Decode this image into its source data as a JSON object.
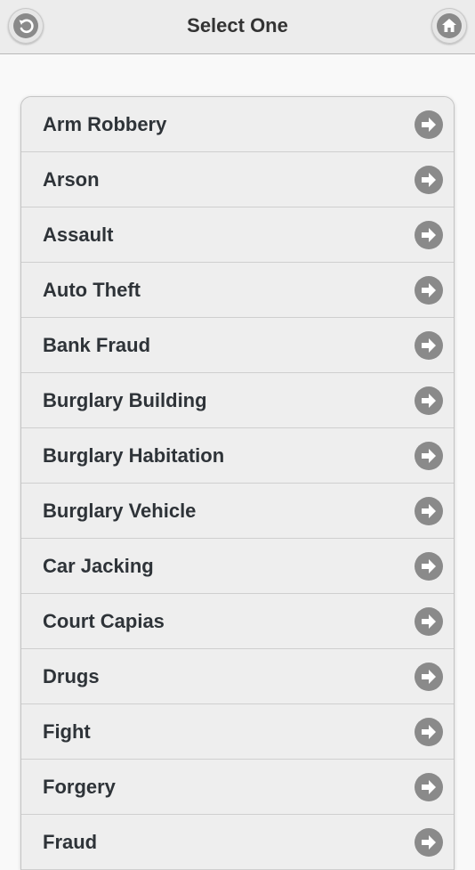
{
  "header": {
    "title": "Select One",
    "back_icon": "back-arrow-icon",
    "home_icon": "home-icon"
  },
  "list": {
    "item_icon": "arrow-right-icon",
    "items": [
      {
        "label": "Arm Robbery"
      },
      {
        "label": "Arson"
      },
      {
        "label": "Assault"
      },
      {
        "label": "Auto Theft"
      },
      {
        "label": "Bank Fraud"
      },
      {
        "label": "Burglary Building"
      },
      {
        "label": "Burglary Habitation"
      },
      {
        "label": "Burglary Vehicle"
      },
      {
        "label": "Car Jacking"
      },
      {
        "label": "Court Capias"
      },
      {
        "label": "Drugs"
      },
      {
        "label": "Fight"
      },
      {
        "label": "Forgery"
      },
      {
        "label": "Fraud"
      }
    ]
  },
  "colors": {
    "header_bg": "#ececec",
    "page_bg": "#f9f9f9",
    "item_bg": "#eeeeee",
    "text": "#2e3338",
    "icon": "#8a8a8a"
  }
}
